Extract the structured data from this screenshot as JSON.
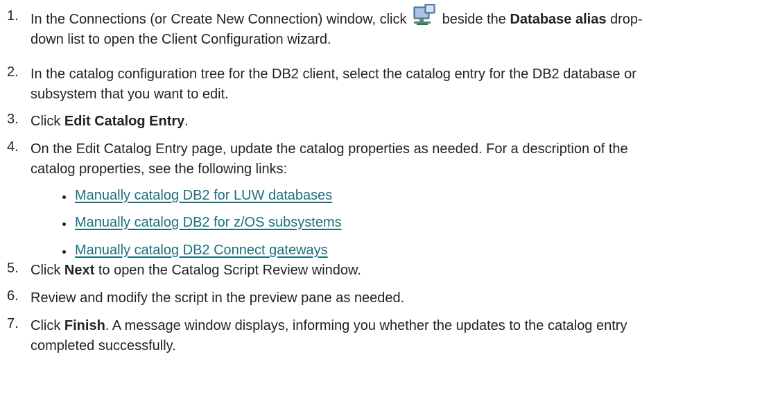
{
  "steps": [
    {
      "number": "1.",
      "line1_before": "In the Connections (or Create New Connection) window, click",
      "icon": "client-configuration-icon",
      "line1_after": "beside the",
      "bold": "Database alias",
      "line1_end": "drop-",
      "line2": "down list to open the Client Configuration wizard."
    },
    {
      "number": "2.",
      "line1": "In the catalog configuration tree for the DB2 client, select the catalog entry for the DB2 database or",
      "line2": "subsystem that you want to edit."
    },
    {
      "number": "3.",
      "before": "Click",
      "bold": "Edit Catalog Entry",
      "after": "."
    },
    {
      "number": "4.",
      "line1": "On the Edit Catalog Entry page, update the catalog properties as needed. For a description of the",
      "line2": "catalog properties, see the following links:",
      "links": [
        "Manually catalog DB2 for LUW databases",
        "Manually catalog DB2 for z/OS subsystems",
        "Manually catalog DB2 Connect gateways"
      ]
    },
    {
      "number": "5.",
      "before": "Click",
      "bold": "Next",
      "after": "to open the Catalog Script Review window."
    },
    {
      "number": "6.",
      "text": "Review and modify the script in the preview pane as needed."
    },
    {
      "number": "7.",
      "before": "Click",
      "bold": "Finish",
      "after": ". A message window displays, informing you whether the updates to the catalog entry",
      "line2": "completed successfully."
    }
  ],
  "colors": {
    "text": "#222222",
    "link": "#1a6f7a"
  }
}
